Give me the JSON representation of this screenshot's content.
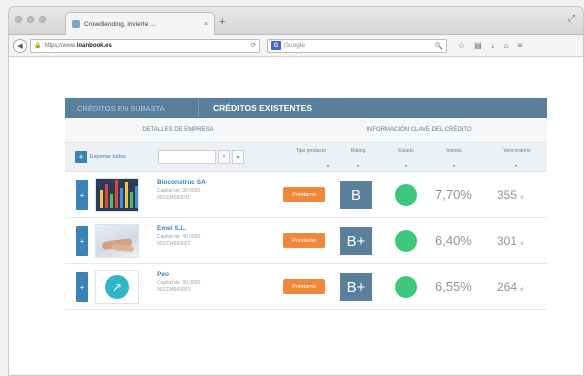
{
  "browser": {
    "tab_title": "Crowdlending, invierte ...",
    "tab_close": "×",
    "new_tab": "+",
    "url_prefix": "https://www.",
    "url_domain": "loanbook.es",
    "search_placeholder": "Google",
    "search_engine_badge": "G"
  },
  "panel": {
    "tab_inactive": "Créditos en subasta",
    "tab_active": "Créditos existentes",
    "header_left": "Detalles de empresa",
    "header_right": "Información clave del crédito",
    "add_label": "Exportar todos",
    "filter_columns": [
      "Tipo producto",
      "Rating",
      "Estado",
      "Interés",
      "Vencimiento"
    ]
  },
  "rows": [
    {
      "name": "Bioconstruc SA",
      "info1": "Capital de: 30.0000",
      "info2": "001234560011",
      "product": "Préstamo",
      "rating": "B",
      "status_color": "#3ec77a",
      "interest": "7,70%",
      "duration": "355",
      "duration_unit": "d",
      "thumb": "chart"
    },
    {
      "name": "Emel S.L.",
      "info1": "Capital de: 40.0000",
      "info2": "001234560022",
      "product": "Préstamo",
      "rating": "B+",
      "status_color": "#3ec77a",
      "interest": "6,40%",
      "duration": "301",
      "duration_unit": "d",
      "thumb": "hands"
    },
    {
      "name": "Peo",
      "info1": "Capital de: 30.0000",
      "info2": "001234560033",
      "product": "Préstamo",
      "rating": "B+",
      "status_color": "#3ec77a",
      "interest": "6,55%",
      "duration": "264",
      "duration_unit": "d",
      "thumb": "logo"
    }
  ]
}
